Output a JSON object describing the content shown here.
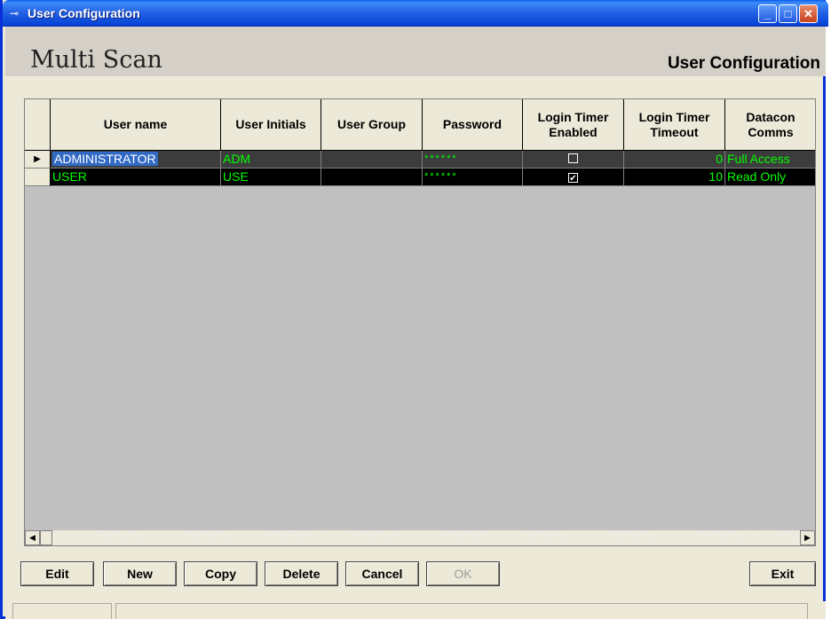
{
  "window": {
    "title": "User Configuration",
    "title_icon": "key-icon",
    "min": "_",
    "max": "□",
    "close": "✕"
  },
  "header": {
    "brand": "Multi Scan",
    "screen_title": "User Configuration"
  },
  "grid": {
    "columns": [
      "User name",
      "User Initials",
      "User Group",
      "Password",
      "Login Timer Enabled",
      "Login Timer Timeout",
      "Datacon Comms"
    ],
    "rows": [
      {
        "indicator": "▶",
        "user_name": "ADMINISTRATOR",
        "initials": "ADM",
        "group": "",
        "password": "******",
        "timer_enabled": false,
        "timeout": "0",
        "comms": "Full Access"
      },
      {
        "indicator": "",
        "user_name": "USER",
        "initials": "USE",
        "group": "",
        "password": "******",
        "timer_enabled": true,
        "timeout": "10",
        "comms": "Read Only"
      }
    ],
    "colors": {
      "grid_bg": "#c0c0c0",
      "row_text": "#00ff00",
      "selection": "#316ac5"
    }
  },
  "scroll": {
    "left": "◀",
    "right": "▶"
  },
  "buttons": {
    "edit": "Edit",
    "new": "New",
    "copy": "Copy",
    "delete": "Delete",
    "cancel": "Cancel",
    "ok": "OK",
    "exit": "Exit"
  }
}
